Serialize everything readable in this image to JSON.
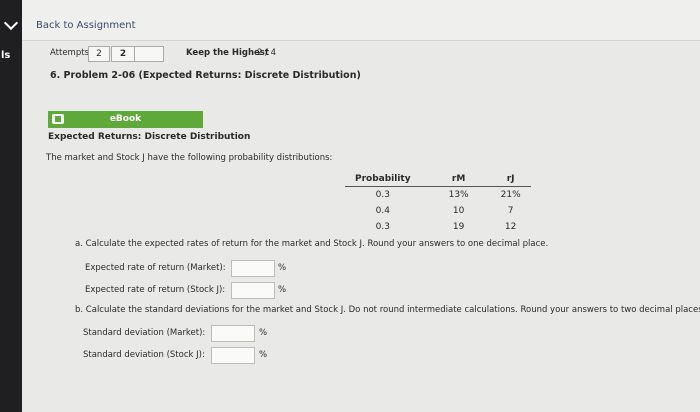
{
  "sidebar": {
    "label": "ls"
  },
  "nav": {
    "back_label": "Back to Assignment"
  },
  "attempts": {
    "label": "Attempts",
    "value1": "2",
    "value2": "2",
    "keep_label": "Keep the Highest",
    "keep_value": "2 / 4"
  },
  "problem": {
    "title": "6. Problem 2-06 (Expected Returns: Discrete Distribution)",
    "ebook_label": "eBook",
    "section_title": "Expected Returns: Discrete Distribution",
    "intro": "The market and Stock J have the following probability distributions:"
  },
  "table": {
    "headers": [
      "Probability",
      "rM",
      "rJ"
    ],
    "rows": [
      [
        "0.3",
        "13%",
        "21%"
      ],
      [
        "0.4",
        "10",
        "7"
      ],
      [
        "0.3",
        "19",
        "12"
      ]
    ]
  },
  "part_a": {
    "prompt": "a. Calculate the expected rates of return for the market and Stock J. Round your answers to one decimal place.",
    "market_label": "Expected rate of return (Market):",
    "stock_label": "Expected rate of return (Stock J):",
    "unit": "%"
  },
  "part_b": {
    "prompt": "b. Calculate the standard deviations for the market and Stock J. Do not round intermediate calculations. Round your answers to two decimal places.",
    "market_label": "Standard deviation (Market):",
    "stock_label": "Standard deviation (Stock J):",
    "unit": "%"
  }
}
